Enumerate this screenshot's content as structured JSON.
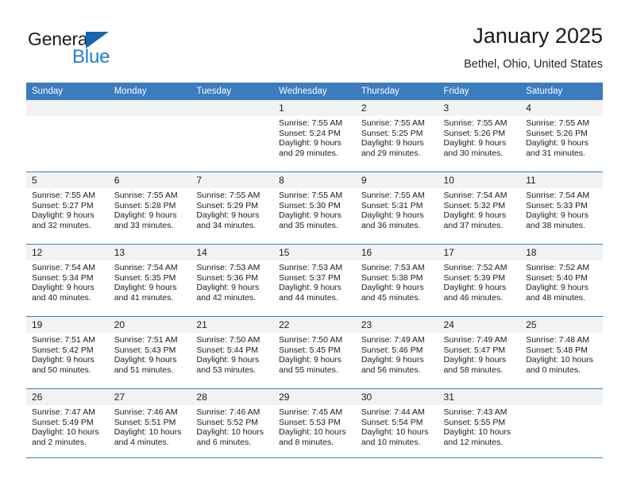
{
  "brand": {
    "name_part1": "General",
    "name_part2": "Blue",
    "triangle_icon": "triangle-icon",
    "color_dark": "#1b1b1b",
    "color_blue": "#1f7fd0"
  },
  "header": {
    "title": "January 2025",
    "subtitle": "Bethel, Ohio, United States"
  },
  "theme": {
    "header_bg": "#3a7cbe",
    "daynum_bg": "#f2f2f2",
    "text": "#1b1b1b"
  },
  "weekday_headers": [
    "Sunday",
    "Monday",
    "Tuesday",
    "Wednesday",
    "Thursday",
    "Friday",
    "Saturday"
  ],
  "labels": {
    "sunrise_prefix": "Sunrise: ",
    "sunset_prefix": "Sunset: ",
    "daylight_prefix": "Daylight: "
  },
  "weeks": [
    [
      {
        "blank": true
      },
      {
        "blank": true
      },
      {
        "blank": true
      },
      {
        "day": "1",
        "sunrise": "Sunrise: 7:55 AM",
        "sunset": "Sunset: 5:24 PM",
        "daylight": "Daylight: 9 hours and 29 minutes."
      },
      {
        "day": "2",
        "sunrise": "Sunrise: 7:55 AM",
        "sunset": "Sunset: 5:25 PM",
        "daylight": "Daylight: 9 hours and 29 minutes."
      },
      {
        "day": "3",
        "sunrise": "Sunrise: 7:55 AM",
        "sunset": "Sunset: 5:26 PM",
        "daylight": "Daylight: 9 hours and 30 minutes."
      },
      {
        "day": "4",
        "sunrise": "Sunrise: 7:55 AM",
        "sunset": "Sunset: 5:26 PM",
        "daylight": "Daylight: 9 hours and 31 minutes."
      }
    ],
    [
      {
        "day": "5",
        "sunrise": "Sunrise: 7:55 AM",
        "sunset": "Sunset: 5:27 PM",
        "daylight": "Daylight: 9 hours and 32 minutes."
      },
      {
        "day": "6",
        "sunrise": "Sunrise: 7:55 AM",
        "sunset": "Sunset: 5:28 PM",
        "daylight": "Daylight: 9 hours and 33 minutes."
      },
      {
        "day": "7",
        "sunrise": "Sunrise: 7:55 AM",
        "sunset": "Sunset: 5:29 PM",
        "daylight": "Daylight: 9 hours and 34 minutes."
      },
      {
        "day": "8",
        "sunrise": "Sunrise: 7:55 AM",
        "sunset": "Sunset: 5:30 PM",
        "daylight": "Daylight: 9 hours and 35 minutes."
      },
      {
        "day": "9",
        "sunrise": "Sunrise: 7:55 AM",
        "sunset": "Sunset: 5:31 PM",
        "daylight": "Daylight: 9 hours and 36 minutes."
      },
      {
        "day": "10",
        "sunrise": "Sunrise: 7:54 AM",
        "sunset": "Sunset: 5:32 PM",
        "daylight": "Daylight: 9 hours and 37 minutes."
      },
      {
        "day": "11",
        "sunrise": "Sunrise: 7:54 AM",
        "sunset": "Sunset: 5:33 PM",
        "daylight": "Daylight: 9 hours and 38 minutes."
      }
    ],
    [
      {
        "day": "12",
        "sunrise": "Sunrise: 7:54 AM",
        "sunset": "Sunset: 5:34 PM",
        "daylight": "Daylight: 9 hours and 40 minutes."
      },
      {
        "day": "13",
        "sunrise": "Sunrise: 7:54 AM",
        "sunset": "Sunset: 5:35 PM",
        "daylight": "Daylight: 9 hours and 41 minutes."
      },
      {
        "day": "14",
        "sunrise": "Sunrise: 7:53 AM",
        "sunset": "Sunset: 5:36 PM",
        "daylight": "Daylight: 9 hours and 42 minutes."
      },
      {
        "day": "15",
        "sunrise": "Sunrise: 7:53 AM",
        "sunset": "Sunset: 5:37 PM",
        "daylight": "Daylight: 9 hours and 44 minutes."
      },
      {
        "day": "16",
        "sunrise": "Sunrise: 7:53 AM",
        "sunset": "Sunset: 5:38 PM",
        "daylight": "Daylight: 9 hours and 45 minutes."
      },
      {
        "day": "17",
        "sunrise": "Sunrise: 7:52 AM",
        "sunset": "Sunset: 5:39 PM",
        "daylight": "Daylight: 9 hours and 46 minutes."
      },
      {
        "day": "18",
        "sunrise": "Sunrise: 7:52 AM",
        "sunset": "Sunset: 5:40 PM",
        "daylight": "Daylight: 9 hours and 48 minutes."
      }
    ],
    [
      {
        "day": "19",
        "sunrise": "Sunrise: 7:51 AM",
        "sunset": "Sunset: 5:42 PM",
        "daylight": "Daylight: 9 hours and 50 minutes."
      },
      {
        "day": "20",
        "sunrise": "Sunrise: 7:51 AM",
        "sunset": "Sunset: 5:43 PM",
        "daylight": "Daylight: 9 hours and 51 minutes."
      },
      {
        "day": "21",
        "sunrise": "Sunrise: 7:50 AM",
        "sunset": "Sunset: 5:44 PM",
        "daylight": "Daylight: 9 hours and 53 minutes."
      },
      {
        "day": "22",
        "sunrise": "Sunrise: 7:50 AM",
        "sunset": "Sunset: 5:45 PM",
        "daylight": "Daylight: 9 hours and 55 minutes."
      },
      {
        "day": "23",
        "sunrise": "Sunrise: 7:49 AM",
        "sunset": "Sunset: 5:46 PM",
        "daylight": "Daylight: 9 hours and 56 minutes."
      },
      {
        "day": "24",
        "sunrise": "Sunrise: 7:49 AM",
        "sunset": "Sunset: 5:47 PM",
        "daylight": "Daylight: 9 hours and 58 minutes."
      },
      {
        "day": "25",
        "sunrise": "Sunrise: 7:48 AM",
        "sunset": "Sunset: 5:48 PM",
        "daylight": "Daylight: 10 hours and 0 minutes."
      }
    ],
    [
      {
        "day": "26",
        "sunrise": "Sunrise: 7:47 AM",
        "sunset": "Sunset: 5:49 PM",
        "daylight": "Daylight: 10 hours and 2 minutes."
      },
      {
        "day": "27",
        "sunrise": "Sunrise: 7:46 AM",
        "sunset": "Sunset: 5:51 PM",
        "daylight": "Daylight: 10 hours and 4 minutes."
      },
      {
        "day": "28",
        "sunrise": "Sunrise: 7:46 AM",
        "sunset": "Sunset: 5:52 PM",
        "daylight": "Daylight: 10 hours and 6 minutes."
      },
      {
        "day": "29",
        "sunrise": "Sunrise: 7:45 AM",
        "sunset": "Sunset: 5:53 PM",
        "daylight": "Daylight: 10 hours and 8 minutes."
      },
      {
        "day": "30",
        "sunrise": "Sunrise: 7:44 AM",
        "sunset": "Sunset: 5:54 PM",
        "daylight": "Daylight: 10 hours and 10 minutes."
      },
      {
        "day": "31",
        "sunrise": "Sunrise: 7:43 AM",
        "sunset": "Sunset: 5:55 PM",
        "daylight": "Daylight: 10 hours and 12 minutes."
      },
      {
        "blank": true
      }
    ]
  ]
}
